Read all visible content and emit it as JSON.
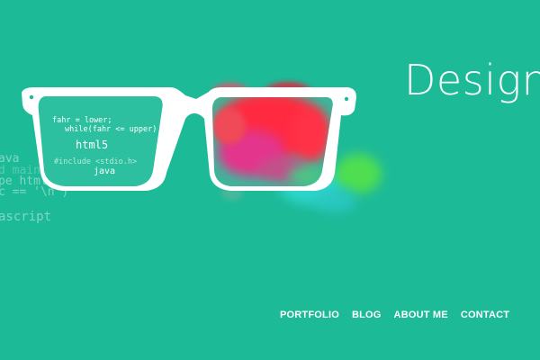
{
  "hero": {
    "title": "Design"
  },
  "nav": {
    "items": [
      "PORTFOLIO",
      "BLOG",
      "ABOUT ME",
      "CONTACT"
    ]
  },
  "artwork": {
    "code_fragments": {
      "large_left_1": "ava",
      "large_left_2": "d main(void)",
      "large_left_3": "pe html>",
      "large_left_4": "c == '\\n')",
      "large_left_5": "ascript",
      "lens_1": "fahr = lower;",
      "lens_2": "while(fahr <= upper)",
      "lens_3": "html5",
      "lens_4": "#include <stdio.h>",
      "lens_5": "java"
    },
    "icon": "eyeglasses-icon"
  },
  "colors": {
    "background": "#1dba98",
    "text": "#ffffff",
    "paint_red": "#ff2b3f",
    "paint_magenta": "#e3358c",
    "paint_green": "#54e24a",
    "paint_cyan": "#2ed9d0"
  }
}
